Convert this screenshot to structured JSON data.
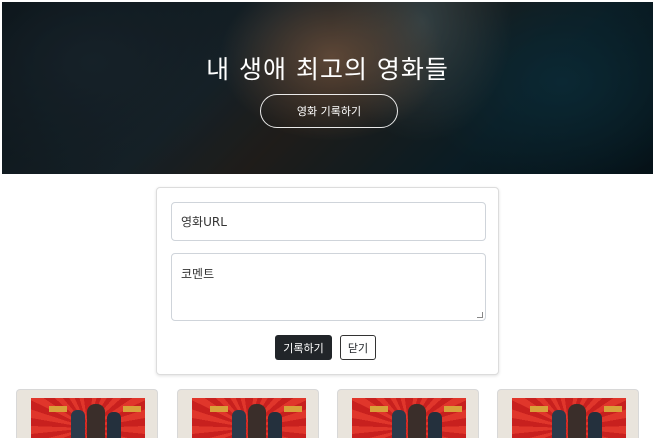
{
  "hero": {
    "title": "내 생애 최고의 영화들",
    "cta_label": "영화 기록하기"
  },
  "form": {
    "url_placeholder": "영화URL",
    "comment_placeholder": "코멘트",
    "save_label": "기록하기",
    "close_label": "닫기"
  },
  "cards": {
    "count_visible": 4
  },
  "colors": {
    "primary_button": "#212529",
    "hero_overlay": "#0e1a20"
  }
}
